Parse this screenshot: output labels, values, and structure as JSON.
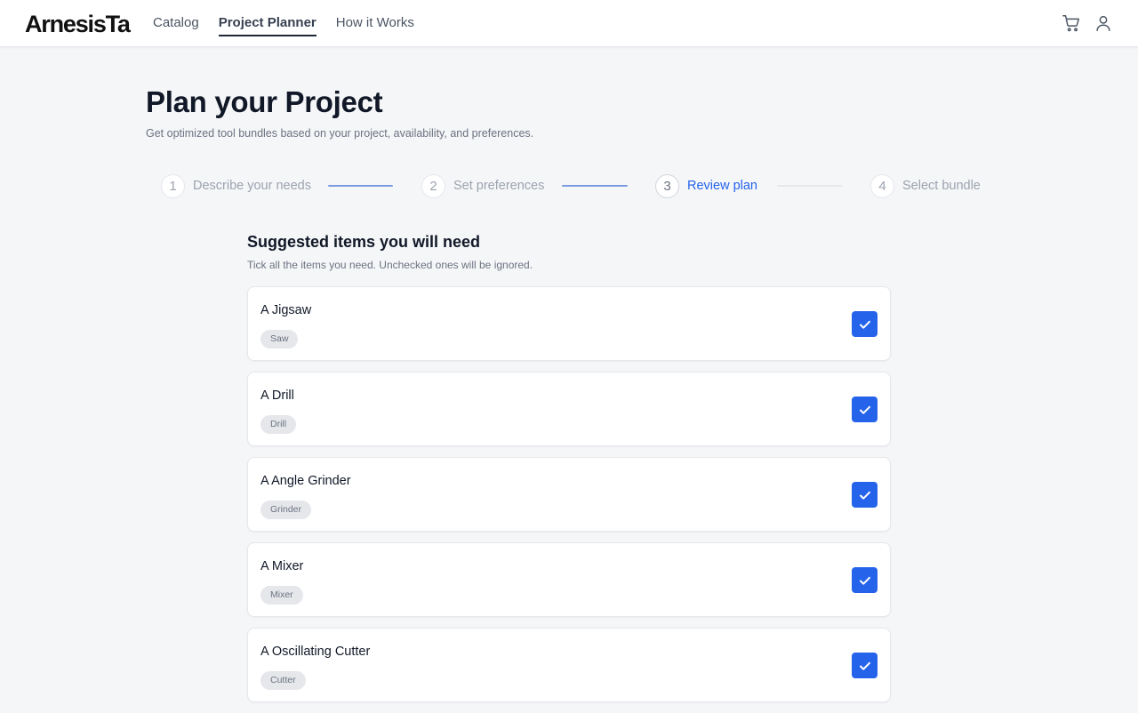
{
  "header": {
    "logo": "ArnesisTa",
    "nav": [
      {
        "label": "Catalog",
        "active": false
      },
      {
        "label": "Project Planner",
        "active": true
      },
      {
        "label": "How it Works",
        "active": false
      }
    ],
    "icons": [
      "cart-icon",
      "user-icon"
    ]
  },
  "page": {
    "title": "Plan your Project",
    "subtitle": "Get optimized tool bundles based on your project, availability, and preferences."
  },
  "stepper": {
    "steps": [
      {
        "number": "1",
        "label": "Describe your needs",
        "state": "complete"
      },
      {
        "number": "2",
        "label": "Set preferences",
        "state": "complete"
      },
      {
        "number": "3",
        "label": "Review plan",
        "state": "current"
      },
      {
        "number": "4",
        "label": "Select bundle",
        "state": "upcoming"
      }
    ]
  },
  "suggestions": {
    "title": "Suggested items you will need",
    "hint": "Tick all the items you need. Unchecked ones will be ignored.",
    "items": [
      {
        "name": "A Jigsaw",
        "tag": "Saw",
        "checked": true
      },
      {
        "name": "A Drill",
        "tag": "Drill",
        "checked": true
      },
      {
        "name": "A Angle Grinder",
        "tag": "Grinder",
        "checked": true
      },
      {
        "name": "A Mixer",
        "tag": "Mixer",
        "checked": true
      },
      {
        "name": "A Oscillating Cutter",
        "tag": "Cutter",
        "checked": true
      }
    ]
  },
  "colors": {
    "accent": "#2563eb",
    "background": "#f5f6f8",
    "connector_done": "#7b9be0",
    "connector_todo": "#e5e7eb"
  }
}
